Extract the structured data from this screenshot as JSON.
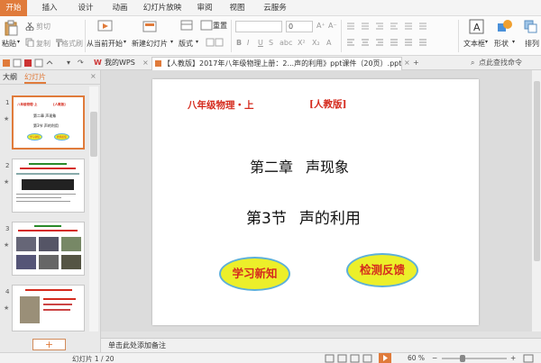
{
  "menu": {
    "tabs": [
      "开始",
      "插入",
      "设计",
      "动画",
      "幻灯片放映",
      "审阅",
      "视图",
      "云服务"
    ]
  },
  "ribbon": {
    "cut": "剪切",
    "paste": "粘贴",
    "copy": "复制",
    "format_painter": "格式刷",
    "from_current": "从当前开始",
    "new_slide": "新建幻灯片",
    "layout": "版式",
    "reset": "重置",
    "font_size": "0",
    "textbox": "文本框",
    "shape": "形状",
    "arrange": "排列"
  },
  "doc_tabs": {
    "my_wps": "我的WPS",
    "document": "【人教版】2017年八年级物理上册：2...声的利用》ppt课件（20页）.ppt",
    "search_hint": "点此查找命令"
  },
  "left_panel": {
    "outline_tab": "大纲",
    "slides_tab": "幻灯片",
    "thumb_numbers": [
      "1",
      "2",
      "3",
      "4"
    ],
    "thumb1": {
      "title_left": "八年级物理·上",
      "title_right": "[人教版]",
      "chapter": "第二章  声现象",
      "section": "第3节  声的利用",
      "btn1": "学习新知",
      "btn2": "检测反馈"
    },
    "add_button": "+"
  },
  "slide": {
    "top_left": "八年级物理・上",
    "top_right": "[人教版]",
    "chapter_label": "第二章",
    "chapter_title": "声现象",
    "section_label": "第3节",
    "section_title": "声的利用",
    "button_learn": "学习新知",
    "button_test": "检测反馈"
  },
  "notes": {
    "placeholder": "单击此处添加备注"
  },
  "status": {
    "slide_counter": "幻灯片 1 / 20",
    "zoom": "60 %"
  },
  "colors": {
    "accent": "#e07b3b",
    "slide_red": "#d52b1e",
    "oval_fill": "#ecef2a",
    "oval_border": "#5db0d8"
  }
}
